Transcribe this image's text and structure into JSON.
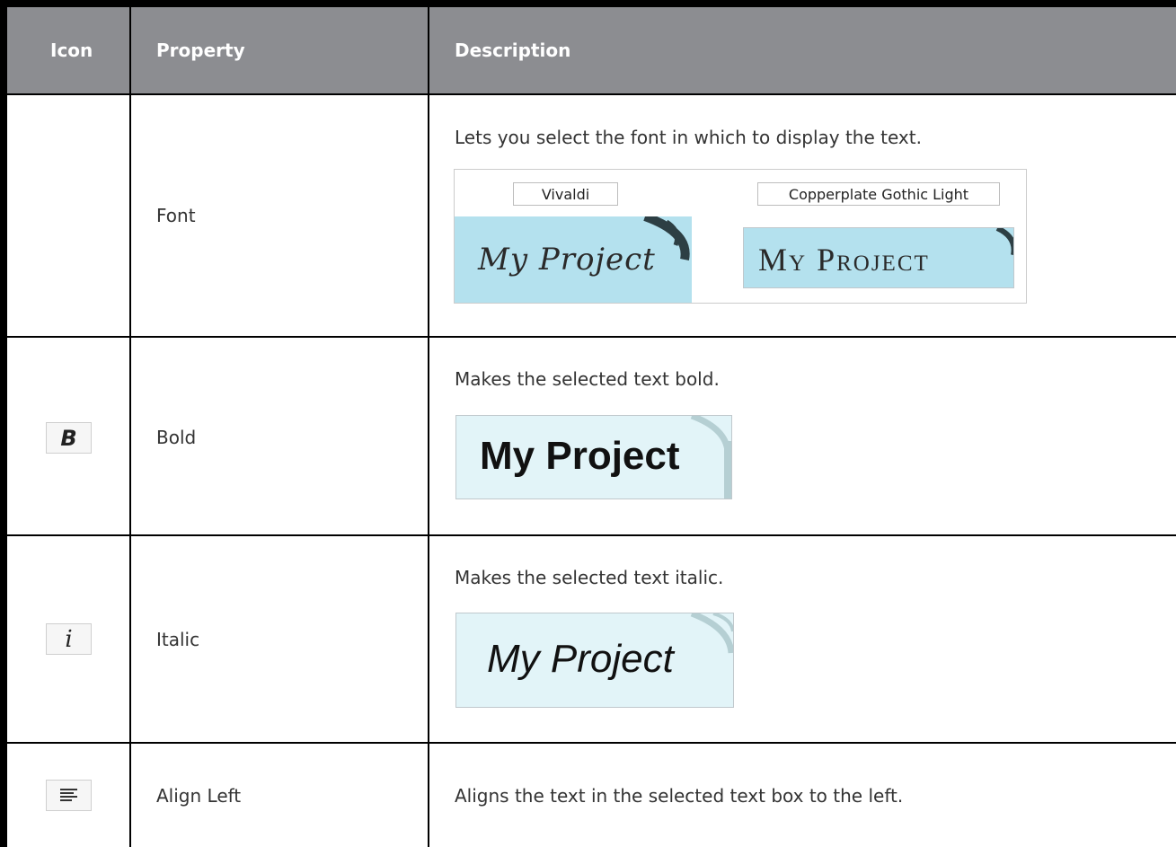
{
  "header": {
    "icon": "Icon",
    "property": "Property",
    "description": "Description"
  },
  "rows": [
    {
      "property": "Font",
      "description": "Lets you select the font in which to display the text.",
      "icon": "",
      "example": {
        "fonts": [
          "Vivaldi",
          "Copperplate Gothic Light"
        ],
        "samples": [
          "My Project",
          "My Project"
        ]
      }
    },
    {
      "property": "Bold",
      "description": "Makes the selected text bold.",
      "icon": "bold-icon",
      "icon_glyph": "B",
      "example": {
        "sample": "My Project"
      }
    },
    {
      "property": "Italic",
      "description": "Makes the selected text italic.",
      "icon": "italic-icon",
      "icon_glyph": "i",
      "example": {
        "sample": "My Project"
      }
    },
    {
      "property": "Align Left",
      "description": "Aligns the text in the selected text box to the left.",
      "icon": "align-left-icon"
    }
  ],
  "colors": {
    "header_bg": "#8c8d91",
    "swatch_blue": "#b4e1ee",
    "swatch_light": "#e2f4f8"
  }
}
